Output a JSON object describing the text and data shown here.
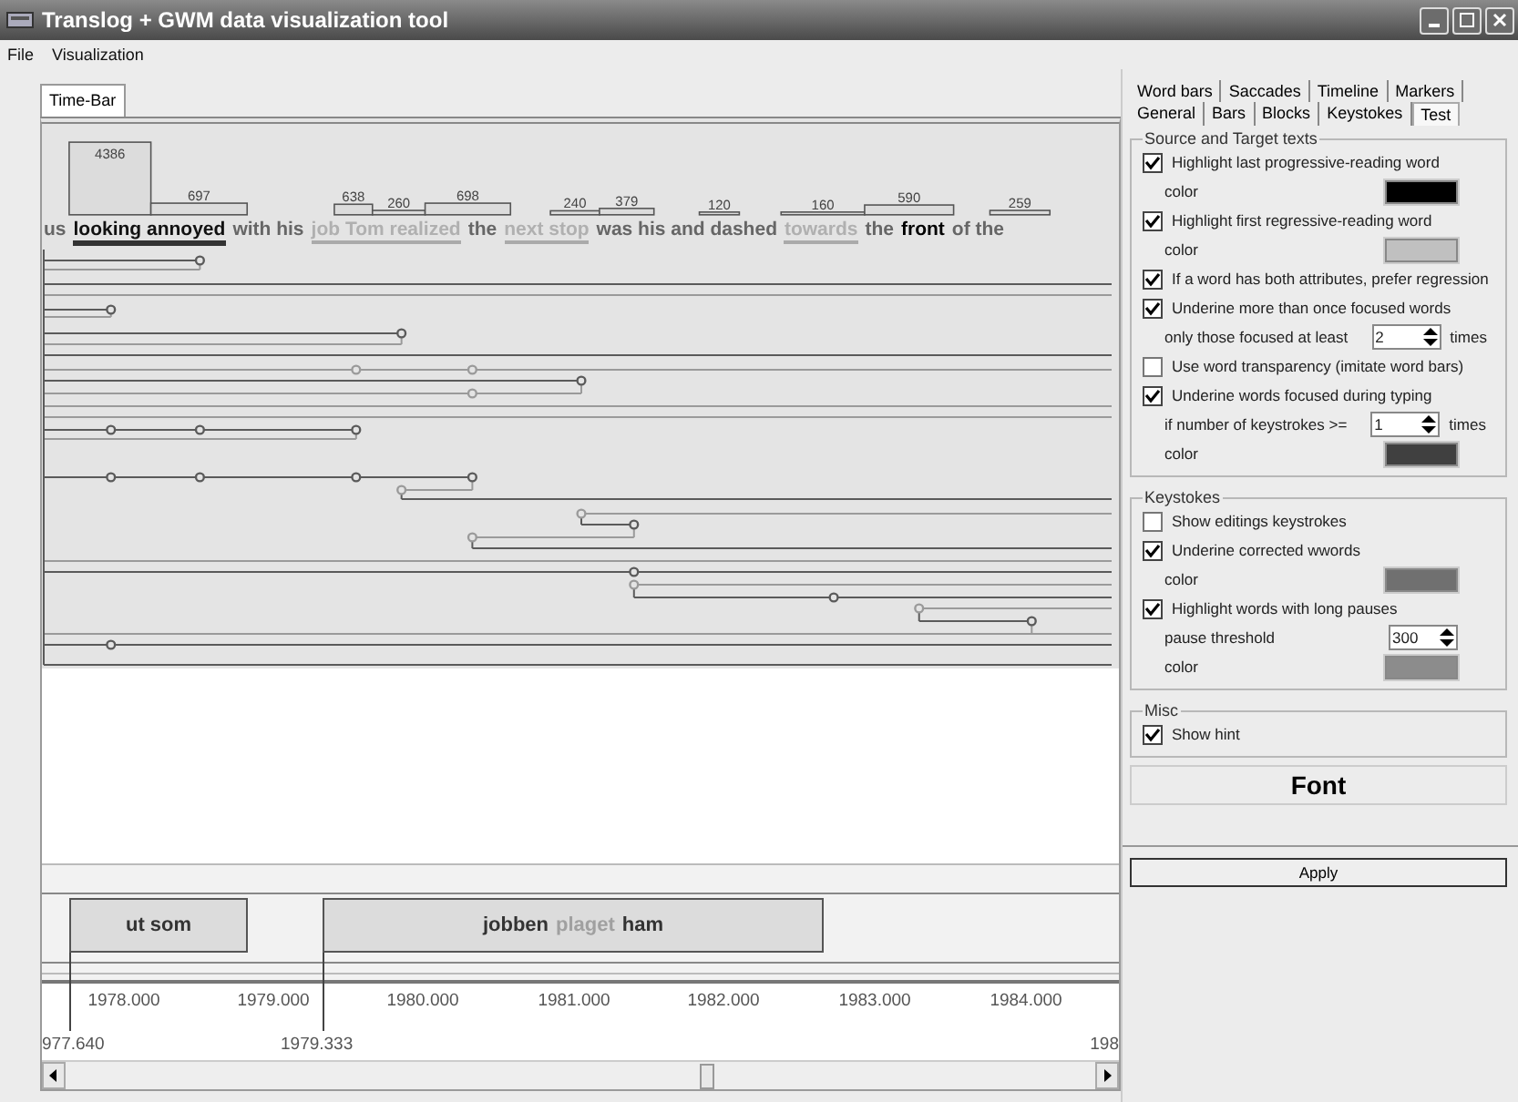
{
  "window": {
    "title": "Translog + GWM data visualization tool"
  },
  "menu": [
    "File",
    "Visualization"
  ],
  "view_tabs": [
    {
      "label": "Time-Bar",
      "selected": true
    }
  ],
  "word_bars": [
    {
      "label": "4386"
    },
    {
      "label": "697"
    },
    {
      "label": "638"
    },
    {
      "label": "260"
    },
    {
      "label": "698"
    },
    {
      "label": "240"
    },
    {
      "label": "379"
    },
    {
      "label": "120"
    },
    {
      "label": "160"
    },
    {
      "label": "590"
    },
    {
      "label": "259"
    }
  ],
  "text_line": [
    {
      "text": "us",
      "kind": "plain"
    },
    {
      "text": "looking annoyed",
      "kind": "progressive"
    },
    {
      "text": "with his",
      "kind": "plain"
    },
    {
      "text": "job Tom realized",
      "kind": "regressive"
    },
    {
      "text": "the",
      "kind": "plain"
    },
    {
      "text": "next stop",
      "kind": "regressive"
    },
    {
      "text": "was his and dashed",
      "kind": "plain"
    },
    {
      "text": "towards",
      "kind": "regressive"
    },
    {
      "text": "the",
      "kind": "plain"
    },
    {
      "text": "front",
      "kind": "strong"
    },
    {
      "text": "of the",
      "kind": "plain"
    }
  ],
  "blocks": [
    {
      "segments": [
        {
          "text": "ut som",
          "kind": "plain"
        }
      ]
    },
    {
      "segments": [
        {
          "text": "jobben",
          "kind": "plain"
        },
        {
          "text": "plaget",
          "kind": "faded"
        },
        {
          "text": "ham",
          "kind": "plain"
        }
      ]
    }
  ],
  "axis_ticks": [
    "1978.000",
    "1979.000",
    "1980.000",
    "1981.000",
    "1982.000",
    "1983.000",
    "1984.000"
  ],
  "block_marks": [
    "977.640",
    "1979.333",
    "198"
  ],
  "settings_tabs": [
    [
      {
        "label": "Word bars",
        "selected": false
      },
      {
        "label": "Saccades",
        "selected": false
      },
      {
        "label": "Timeline",
        "selected": false
      },
      {
        "label": "Markers",
        "selected": false
      }
    ],
    [
      {
        "label": "General",
        "selected": false
      },
      {
        "label": "Bars",
        "selected": false
      },
      {
        "label": "Blocks",
        "selected": false
      },
      {
        "label": "Keystokes",
        "selected": false
      },
      {
        "label": "Test",
        "selected": true
      }
    ]
  ],
  "groups": [
    {
      "title": "Source and Target texts",
      "items": [
        {
          "kind": "check",
          "label": "Highlight last progressive-reading word",
          "checked": true
        },
        {
          "kind": "color",
          "label": "color",
          "color": "#000000"
        },
        {
          "kind": "check",
          "label": "Highlight first regressive-reading word",
          "checked": true
        },
        {
          "kind": "color",
          "label": "color",
          "color": "#c0c0c0"
        },
        {
          "kind": "check",
          "label": "If a word has both attributes, prefer regression",
          "checked": true
        },
        {
          "kind": "check",
          "label": "Underine more than once focused words",
          "checked": true
        },
        {
          "kind": "spin",
          "label": "only those focused at least",
          "value": "2",
          "unit": "times"
        },
        {
          "kind": "check",
          "label": "Use word transparency (imitate word bars)",
          "checked": false
        },
        {
          "kind": "check",
          "label": "Underine words focused during typing",
          "checked": true
        },
        {
          "kind": "spin",
          "label": "if number of keystrokes >=",
          "value": "1",
          "unit": "times"
        },
        {
          "kind": "color",
          "label": "color",
          "color": "#404040"
        }
      ]
    },
    {
      "title": "Keystokes",
      "items": [
        {
          "kind": "check",
          "label": "Show editings keystrokes",
          "checked": false
        },
        {
          "kind": "check",
          "label": "Underine corrected wwords",
          "checked": true
        },
        {
          "kind": "color",
          "label": "color",
          "color": "#707070"
        },
        {
          "kind": "check",
          "label": "Highlight words with long pauses",
          "checked": true
        },
        {
          "kind": "spin",
          "label": "pause threshold",
          "value": "300"
        },
        {
          "kind": "color",
          "label": "color",
          "color": "#8c8c8c"
        }
      ]
    },
    {
      "title": "Misc",
      "items": [
        {
          "kind": "check",
          "label": "Show hint",
          "checked": true
        }
      ]
    }
  ],
  "font_button": "Font",
  "apply_button": "Apply"
}
